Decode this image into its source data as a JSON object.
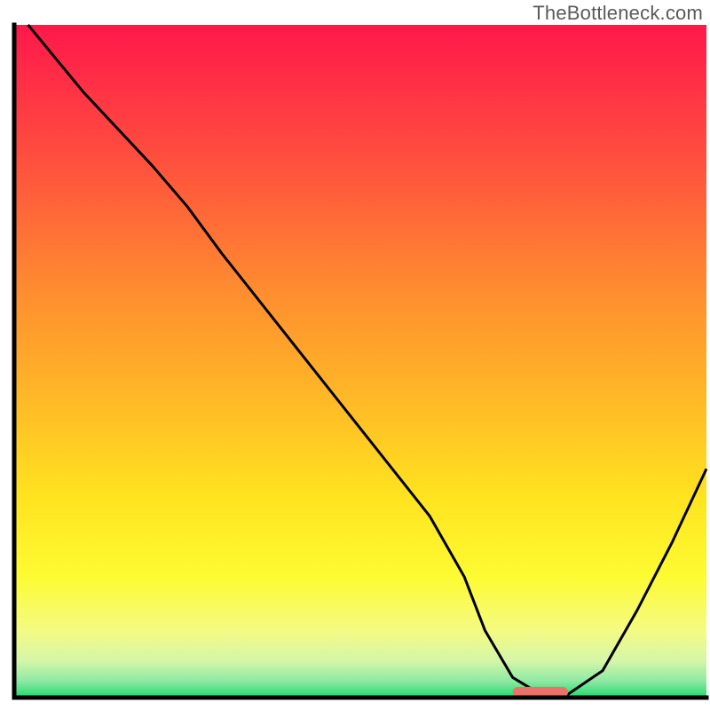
{
  "watermark": "TheBottleneck.com",
  "chart_data": {
    "type": "line",
    "title": "",
    "xlabel": "",
    "ylabel": "",
    "xlim": [
      0,
      100
    ],
    "ylim": [
      0,
      100
    ],
    "x": [
      2,
      10,
      20,
      25,
      30,
      40,
      50,
      60,
      65,
      68,
      72,
      76,
      80,
      85,
      90,
      95,
      100
    ],
    "values": [
      100,
      90,
      79,
      73,
      66,
      53,
      40,
      27,
      18,
      10,
      3,
      0.5,
      0.5,
      4,
      13,
      23,
      34
    ],
    "marker": {
      "x_center": 76,
      "width": 8,
      "y": 0.8,
      "color": "#e9736a"
    },
    "background": {
      "type": "vertical_gradient",
      "stops": [
        {
          "pos": 0.0,
          "color": "#ff184b"
        },
        {
          "pos": 0.2,
          "color": "#ff4f3e"
        },
        {
          "pos": 0.4,
          "color": "#ff8e2f"
        },
        {
          "pos": 0.55,
          "color": "#ffb727"
        },
        {
          "pos": 0.7,
          "color": "#ffe31f"
        },
        {
          "pos": 0.82,
          "color": "#fdfb32"
        },
        {
          "pos": 0.9,
          "color": "#f4fb82"
        },
        {
          "pos": 0.945,
          "color": "#d6f6a8"
        },
        {
          "pos": 0.975,
          "color": "#8fe9a4"
        },
        {
          "pos": 1.0,
          "color": "#21d96f"
        }
      ]
    },
    "axes_color": "#000000",
    "line_color": "#000000"
  }
}
